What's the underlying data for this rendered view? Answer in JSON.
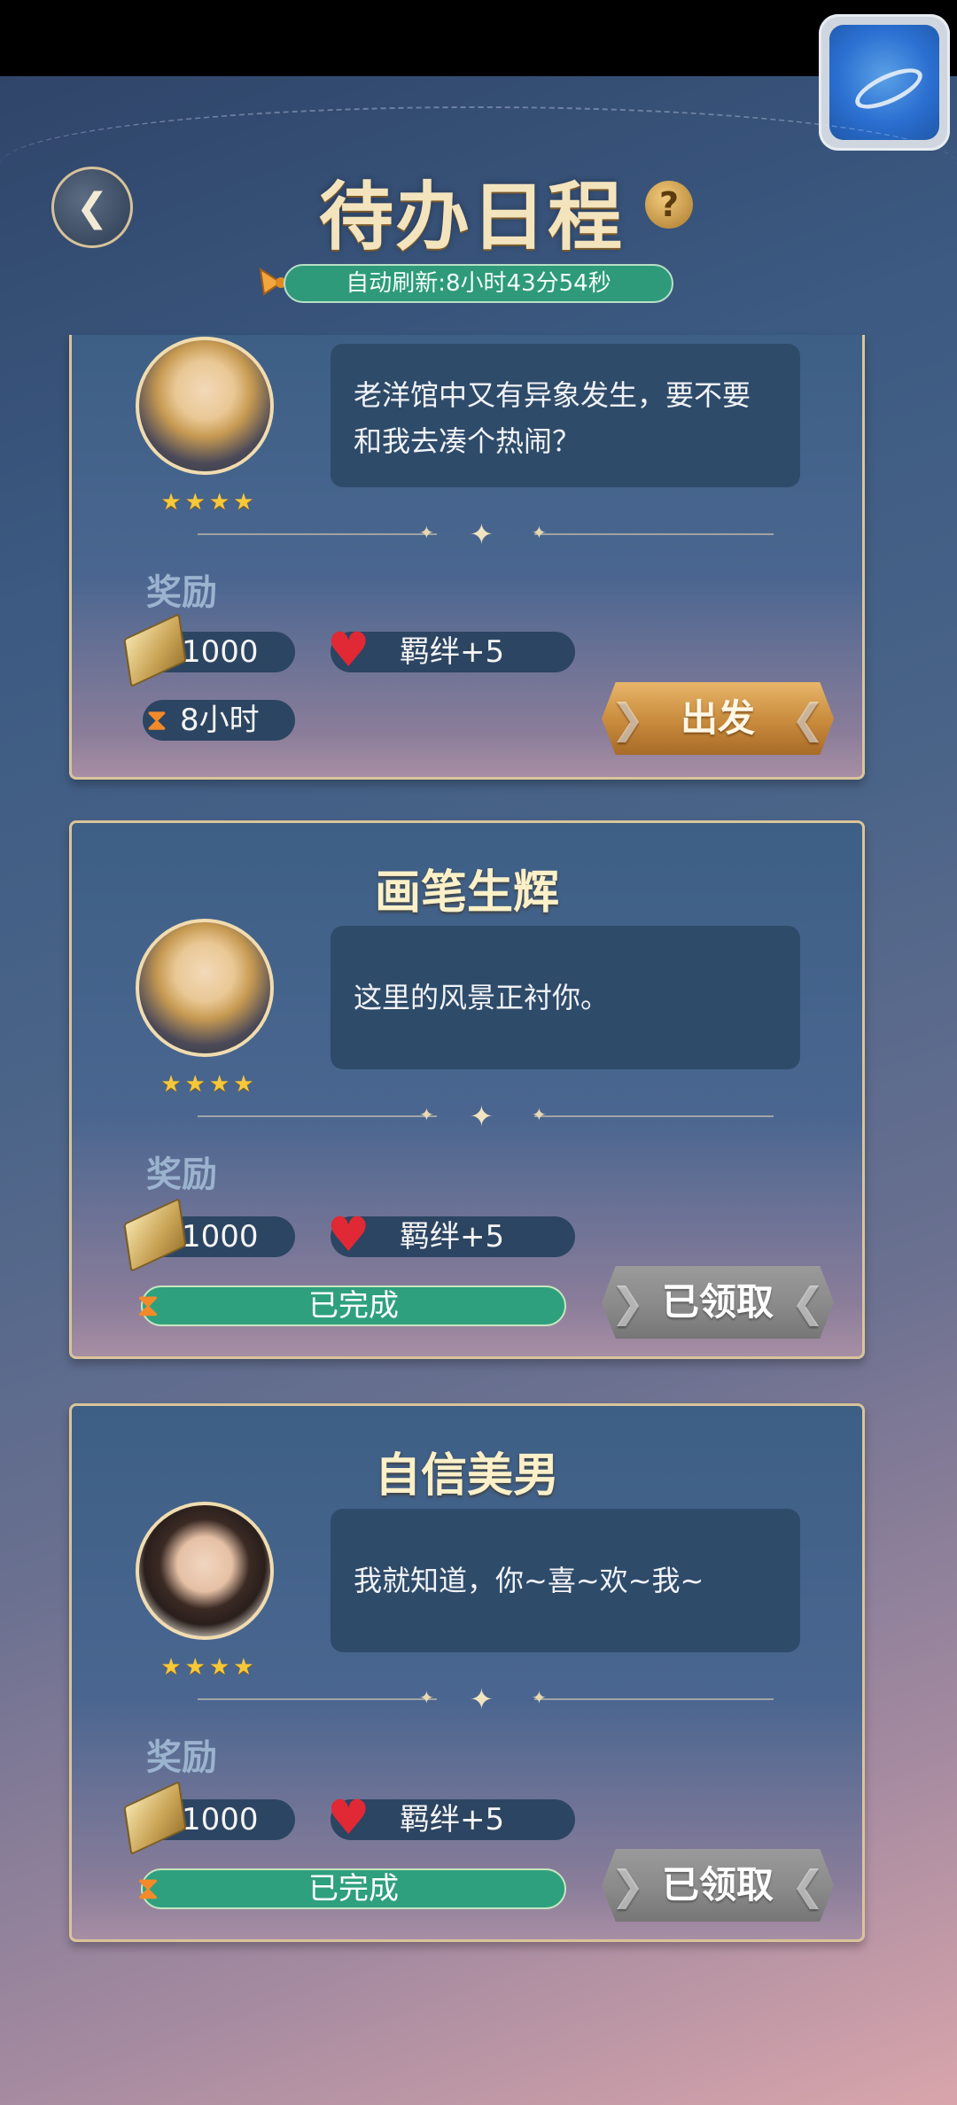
{
  "header": {
    "title": "待办日程",
    "help": "?",
    "refresh_text": "自动刷新:8小时43分54秒",
    "back_icon": "back-arrow-icon"
  },
  "cards": [
    {
      "title": "",
      "dialogue": "老洋馆中又有异象发生，要不要和我去凑个热闹？",
      "stars": "★★★★",
      "reward_label": "奖励",
      "coin_amount": "1000",
      "bond_reward": "羁绊+5",
      "duration": "8小时",
      "button_label": "出发",
      "status": ""
    },
    {
      "title": "画笔生辉",
      "dialogue": "这里的风景正衬你。",
      "stars": "★★★★",
      "reward_label": "奖励",
      "coin_amount": "1000",
      "bond_reward": "羁绊+5",
      "duration": "",
      "button_label": "已领取",
      "status": "已完成"
    },
    {
      "title": "自信美男",
      "dialogue": "我就知道，你~喜~欢~我~",
      "stars": "★★★★",
      "reward_label": "奖励",
      "coin_amount": "1000",
      "bond_reward": "羁绊+5",
      "duration": "",
      "button_label": "已领取",
      "status": "已完成"
    }
  ],
  "colors": {
    "gold_accent": "#d9c49a",
    "progress_green": "#2fa07e",
    "go_button": "#c88a3c",
    "claimed_button": "#8a8a8a"
  }
}
